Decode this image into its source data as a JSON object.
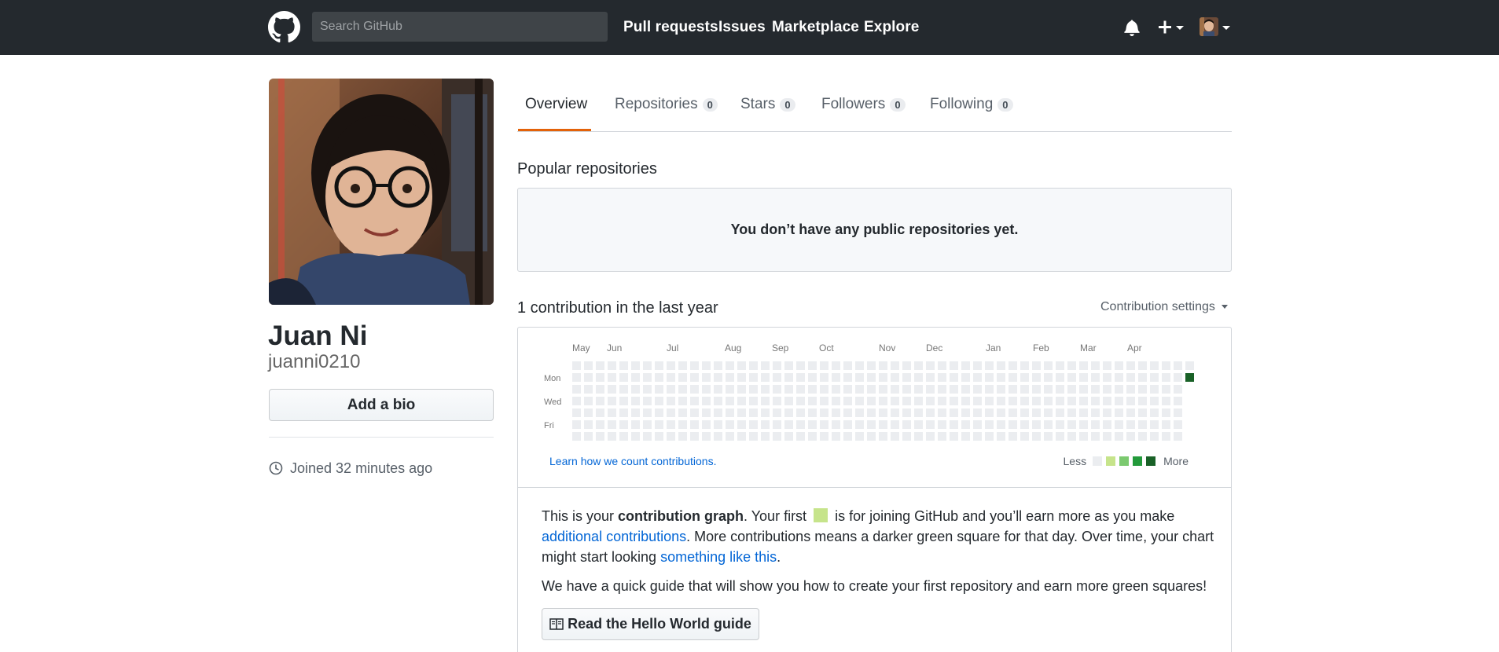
{
  "header": {
    "search_placeholder": "Search GitHub",
    "nav": [
      "Pull requests",
      "Issues",
      "Marketplace",
      "Explore"
    ],
    "icons": [
      "github-logo-icon",
      "bell-icon",
      "plus-icon",
      "avatar"
    ]
  },
  "profile": {
    "full_name": "Juan Ni",
    "username": "juanni0210",
    "bio_button": "Add a bio",
    "joined": "Joined 32 minutes ago"
  },
  "tabs": [
    {
      "label": "Overview",
      "count": null,
      "active": true
    },
    {
      "label": "Repositories",
      "count": "0"
    },
    {
      "label": "Stars",
      "count": "0"
    },
    {
      "label": "Followers",
      "count": "0"
    },
    {
      "label": "Following",
      "count": "0"
    }
  ],
  "popular": {
    "title": "Popular repositories",
    "empty_message": "You don’t have any public repositories yet."
  },
  "contributions": {
    "title": "1 contribution in the last year",
    "settings_label": "Contribution settings",
    "learn_link": "Learn how we count contributions.",
    "legend_less": "Less",
    "legend_more": "More",
    "legend_colors": [
      "#ebedf0",
      "#c6e48b",
      "#7bc96f",
      "#239a3b",
      "#196127"
    ],
    "months": [
      "May",
      "Jun",
      "Jul",
      "Aug",
      "Sep",
      "Oct",
      "Nov",
      "Dec",
      "Jan",
      "Feb",
      "Mar",
      "Apr"
    ],
    "day_labels": [
      "Mon",
      "Wed",
      "Fri"
    ],
    "weeks": 53,
    "last_week_days": 2,
    "filled_cell": {
      "week": 53,
      "day": 1,
      "color": "#196127"
    }
  },
  "intro": {
    "p1_a": "This is your ",
    "p1_bold": "contribution graph",
    "p1_b": ". Your first ",
    "p1_c": " is for joining GitHub and you’ll earn more as you make ",
    "p1_link1": "additional contributions",
    "p1_d": ". More contributions means a darker green square for that day. Over time, your chart might start looking ",
    "p1_link2": "something like this",
    "p1_e": ".",
    "p2": "We have a quick guide that will show you how to create your first repository and earn more green squares!",
    "guide_button": "Read the Hello World guide"
  }
}
